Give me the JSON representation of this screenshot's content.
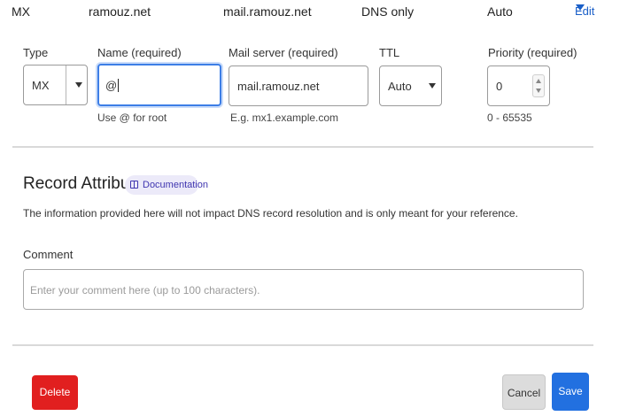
{
  "summary": {
    "type": "MX",
    "name": "ramouz.net",
    "content": "mail.ramouz.net",
    "proxy_status": "DNS only",
    "ttl": "Auto",
    "edit_label": "Edit"
  },
  "form": {
    "type": {
      "label": "Type",
      "value": "MX"
    },
    "name": {
      "label": "Name (required)",
      "value": "@",
      "hint": "Use @ for root"
    },
    "mail_server": {
      "label": "Mail server (required)",
      "value": "mail.ramouz.net",
      "hint": "E.g. mx1.example.com"
    },
    "ttl": {
      "label": "TTL",
      "value": "Auto"
    },
    "priority": {
      "label": "Priority (required)",
      "value": "0",
      "hint": "0 - 65535"
    }
  },
  "record_attributes": {
    "title": "Record Attributes",
    "doc_link": "Documentation",
    "description": "The information provided here will not impact DNS record resolution and is only meant for your reference.",
    "comment_label": "Comment",
    "comment_placeholder": "Enter your comment here (up to 100 characters)."
  },
  "actions": {
    "delete_label": "Delete",
    "cancel_label": "Cancel",
    "save_label": "Save"
  },
  "colors": {
    "primary": "#2270e0",
    "danger": "#e11f1f",
    "focus": "#3d7ee6",
    "link": "#1a5fc8"
  },
  "icons": [
    "chevron-down-icon",
    "book-icon",
    "spinner-up-icon",
    "spinner-down-icon"
  ]
}
